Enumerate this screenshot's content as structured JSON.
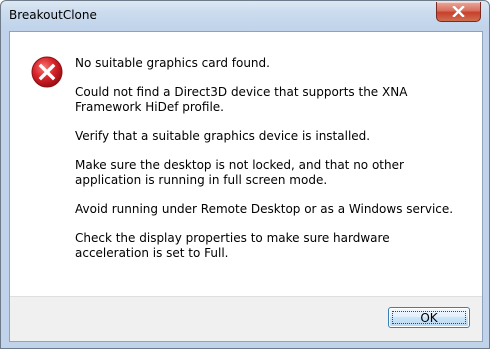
{
  "window": {
    "title": "BreakoutClone"
  },
  "titlebar": {
    "close_icon": "close-icon"
  },
  "dialog": {
    "icon": "error-icon",
    "messages": [
      "No suitable graphics card found.",
      "Could not find a Direct3D device that supports the XNA Framework HiDef profile.",
      "Verify that a suitable graphics device is installed.",
      "Make sure the desktop is not locked, and that no other application is running in full screen mode.",
      "Avoid running under Remote Desktop or as a Windows service.",
      "Check the display properties to make sure hardware acceleration is set to Full."
    ],
    "ok_label": "OK"
  },
  "colors": {
    "error_red": "#d8232a",
    "close_button": "#c7402b",
    "button_border": "#3c7fb1"
  }
}
